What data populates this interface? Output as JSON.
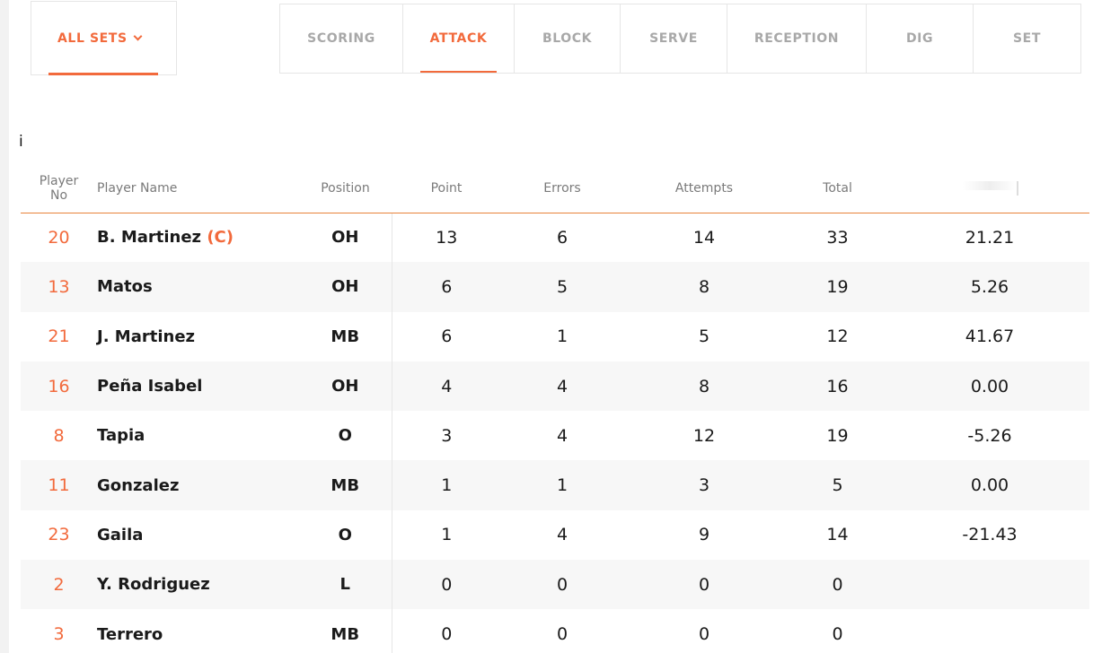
{
  "sets_dropdown": {
    "label": "ALL SETS"
  },
  "tabs": [
    {
      "label": "SCORING",
      "active": false
    },
    {
      "label": "ATTACK",
      "active": true
    },
    {
      "label": "BLOCK",
      "active": false
    },
    {
      "label": "SERVE",
      "active": false
    },
    {
      "label": "RECEPTION",
      "active": false
    },
    {
      "label": "DIG",
      "active": false
    },
    {
      "label": "SET",
      "active": false
    }
  ],
  "info_marker": "i",
  "table": {
    "headers": {
      "player_no_1": "Player",
      "player_no_2": "No",
      "player_name": "Player Name",
      "position": "Position",
      "point": "Point",
      "errors": "Errors",
      "attempts": "Attempts",
      "total": "Total"
    },
    "rows": [
      {
        "no": "20",
        "name": "B. Martinez",
        "captain": "(C)",
        "position": "OH",
        "point": "13",
        "errors": "6",
        "attempts": "14",
        "total": "33",
        "pct": "21.21"
      },
      {
        "no": "13",
        "name": "Matos",
        "captain": "",
        "position": "OH",
        "point": "6",
        "errors": "5",
        "attempts": "8",
        "total": "19",
        "pct": "5.26"
      },
      {
        "no": "21",
        "name": "J. Martinez",
        "captain": "",
        "position": "MB",
        "point": "6",
        "errors": "1",
        "attempts": "5",
        "total": "12",
        "pct": "41.67"
      },
      {
        "no": "16",
        "name": "Peña Isabel",
        "captain": "",
        "position": "OH",
        "point": "4",
        "errors": "4",
        "attempts": "8",
        "total": "16",
        "pct": "0.00"
      },
      {
        "no": "8",
        "name": "Tapia",
        "captain": "",
        "position": "O",
        "point": "3",
        "errors": "4",
        "attempts": "12",
        "total": "19",
        "pct": "-5.26"
      },
      {
        "no": "11",
        "name": "Gonzalez",
        "captain": "",
        "position": "MB",
        "point": "1",
        "errors": "1",
        "attempts": "3",
        "total": "5",
        "pct": "0.00"
      },
      {
        "no": "23",
        "name": "Gaila",
        "captain": "",
        "position": "O",
        "point": "1",
        "errors": "4",
        "attempts": "9",
        "total": "14",
        "pct": "-21.43"
      },
      {
        "no": "2",
        "name": "Y. Rodriguez",
        "captain": "",
        "position": "L",
        "point": "0",
        "errors": "0",
        "attempts": "0",
        "total": "0",
        "pct": ""
      },
      {
        "no": "3",
        "name": "Terrero",
        "captain": "",
        "position": "MB",
        "point": "0",
        "errors": "0",
        "attempts": "0",
        "total": "0",
        "pct": ""
      }
    ]
  },
  "colors": {
    "accent": "#f26a3c",
    "muted": "#a8a8a8",
    "row_alt": "#f7f7f7"
  }
}
